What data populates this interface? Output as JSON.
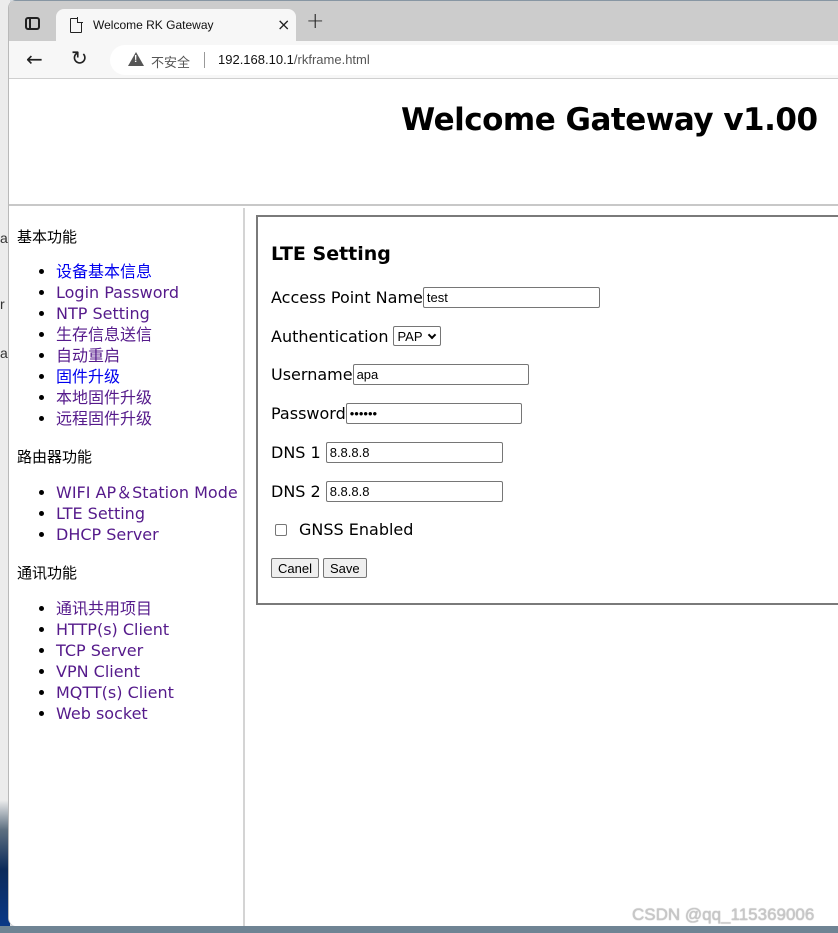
{
  "browser": {
    "tab_title": "Welcome RK Gateway",
    "tab_close": "×",
    "new_tab": "+",
    "back": "←",
    "reload": "↻",
    "security_label": "不安全",
    "url_host": "192.168.10.1",
    "url_path": "/rkframe.html"
  },
  "header": {
    "title": "Welcome Gateway v1.00"
  },
  "sidebar": {
    "sections": [
      {
        "heading": "基本功能",
        "items": [
          {
            "label": "设备基本信息",
            "visited": false
          },
          {
            "label": "Login Password",
            "visited": true
          },
          {
            "label": "NTP Setting",
            "visited": true
          },
          {
            "label": "生存信息送信",
            "visited": true
          },
          {
            "label": "自动重启",
            "visited": true
          },
          {
            "label": "固件升级",
            "visited": false
          },
          {
            "label": "本地固件升级",
            "visited": true
          },
          {
            "label": "远程固件升级",
            "visited": true
          }
        ]
      },
      {
        "heading": "路由器功能",
        "items": [
          {
            "label": "WIFI AP＆Station Mode",
            "visited": true
          },
          {
            "label": "LTE Setting",
            "visited": true
          },
          {
            "label": "DHCP Server",
            "visited": true
          }
        ]
      },
      {
        "heading": "通讯功能",
        "items": [
          {
            "label": "通讯共用项目",
            "visited": true
          },
          {
            "label": "HTTP(s) Client",
            "visited": true
          },
          {
            "label": "TCP Server",
            "visited": true
          },
          {
            "label": "VPN Client",
            "visited": true
          },
          {
            "label": "MQTT(s) Client",
            "visited": true
          },
          {
            "label": "Web socket",
            "visited": true
          }
        ]
      }
    ]
  },
  "form": {
    "title": "LTE Setting",
    "apn": {
      "label": "Access Point Name",
      "value": "test"
    },
    "auth": {
      "label": "Authentication",
      "selected": "PAP"
    },
    "username": {
      "label": "Username",
      "value": "apa"
    },
    "password": {
      "label": "Password",
      "value": "••••••"
    },
    "dns1": {
      "label": "DNS 1",
      "value": "8.8.8.8"
    },
    "dns2": {
      "label": "DNS 2",
      "value": "8.8.8.8"
    },
    "gnss": {
      "label": "GNSS Enabled",
      "checked": false
    },
    "cancel_label": "Canel",
    "save_label": "Save"
  },
  "watermark": "CSDN @qq_115369006",
  "colors": {
    "link_visited": "#551a8b",
    "link_unvisited": "#0000ee"
  }
}
